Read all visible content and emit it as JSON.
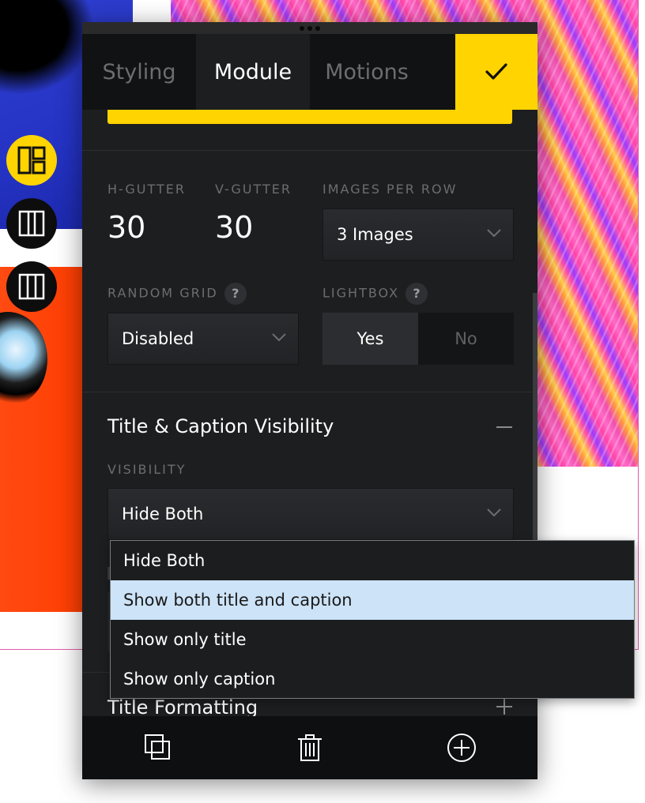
{
  "tabs": [
    {
      "label": "Styling",
      "active": false
    },
    {
      "label": "Module",
      "active": true
    },
    {
      "label": "Motions",
      "active": false
    }
  ],
  "confirm_icon": "checkmark-icon",
  "side_buttons": [
    {
      "icon": "layout-grid-icon",
      "active": true
    },
    {
      "icon": "two-columns-icon",
      "active": false
    },
    {
      "icon": "three-columns-icon",
      "active": false
    }
  ],
  "grid": {
    "h_gutter_label": "H-GUTTER",
    "h_gutter_value": "30",
    "v_gutter_label": "V-GUTTER",
    "v_gutter_value": "30",
    "images_per_row_label": "IMAGES PER ROW",
    "images_per_row_value": "3 Images",
    "random_grid_label": "RANDOM GRID",
    "random_grid_value": "Disabled",
    "lightbox_label": "LIGHTBOX",
    "lightbox_yes": "Yes",
    "lightbox_no": "No",
    "lightbox_selected": "Yes",
    "help_glyph": "?"
  },
  "visibility_section": {
    "title": "Title & Caption Visibility",
    "expanded": true,
    "visibility_label": "VISIBILITY",
    "visibility_value": "Hide Both"
  },
  "title_formatting_section": {
    "title": "Title Formatting",
    "expanded": false
  },
  "dropdown": {
    "options": [
      "Hide Both",
      "Show both title and caption",
      "Show only title",
      "Show only caption"
    ],
    "highlighted": "Show both title and caption"
  },
  "footer": {
    "icons": [
      "duplicate-icon",
      "trash-icon",
      "add-circle-icon"
    ]
  },
  "colors": {
    "accent": "#ffd400",
    "panel_bg": "#1d1e20",
    "tab_bar_bg": "#111213",
    "highlight": "#cde3f7"
  }
}
